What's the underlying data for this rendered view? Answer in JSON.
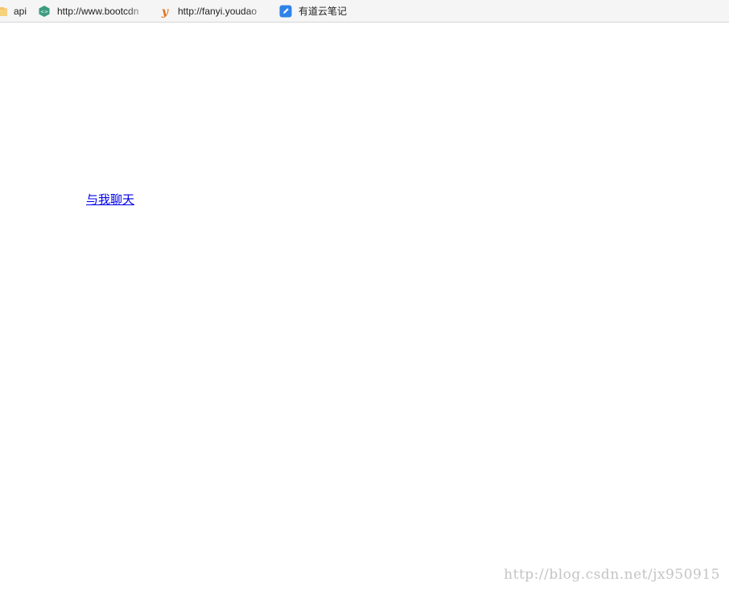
{
  "bookmarks": [
    {
      "label": "api",
      "icon": "folder-icon"
    },
    {
      "label": "http://www.bootcdn",
      "icon": "bootcdn-icon"
    },
    {
      "label": "http://fanyi.youdao",
      "icon": "youdao-icon"
    },
    {
      "label": "有道云笔记",
      "icon": "youdao-note-icon"
    }
  ],
  "main": {
    "link_text": "与我聊天"
  },
  "watermark": "http://blog.csdn.net/jx950915",
  "colors": {
    "link": "#0000ee",
    "toolbar_bg": "#f5f5f5",
    "watermark": "#c4c4c4"
  }
}
